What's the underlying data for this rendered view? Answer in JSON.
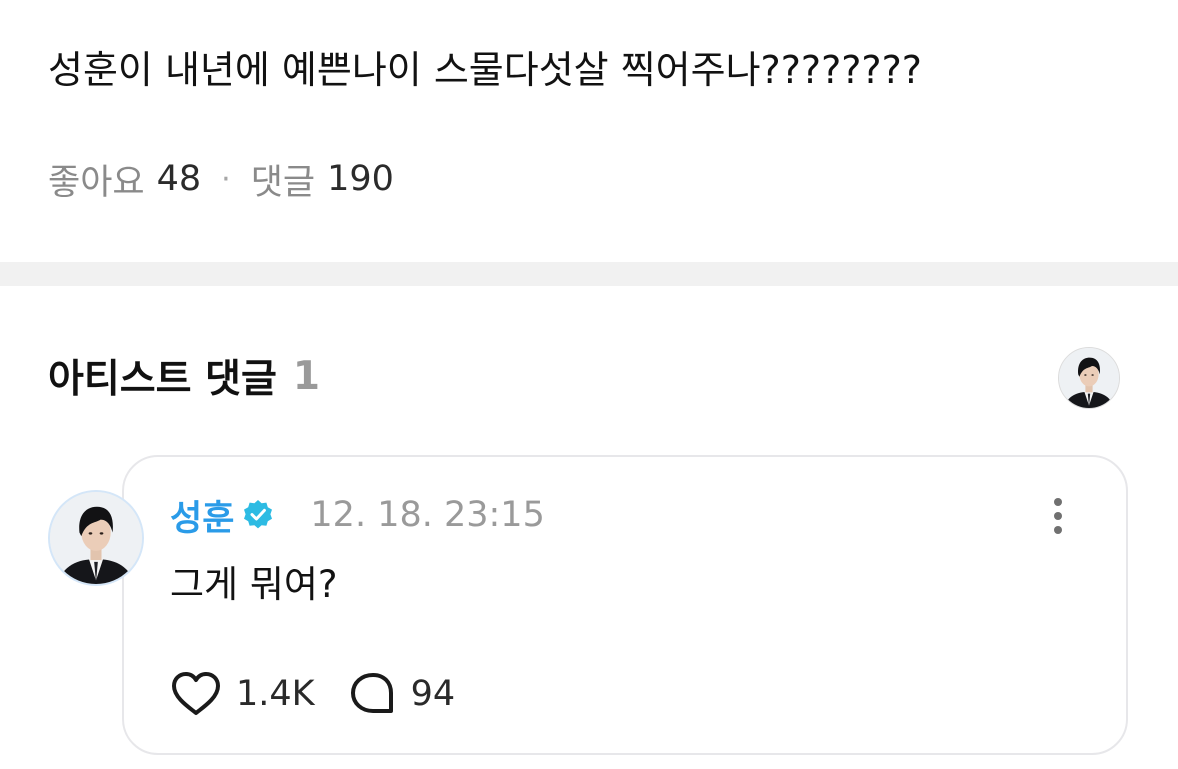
{
  "post": {
    "text": "성훈이 내년에 예쁜나이 스물다섯살 찍어주나????????"
  },
  "stats": {
    "likes_label": "좋아요",
    "likes_count": "48",
    "separator": "·",
    "comments_label": "댓글",
    "comments_count": "190"
  },
  "artist_section": {
    "title": "아티스트 댓글",
    "count": "1"
  },
  "comment": {
    "author": "성훈",
    "time": "12. 18. 23:15",
    "text": "그게 뭐여?",
    "likes": "1.4K",
    "replies": "94"
  },
  "icons": {
    "verified": "verified-badge-icon",
    "more": "more-vertical-icon",
    "like": "heart-icon",
    "reply": "speech-bubble-icon"
  },
  "colors": {
    "author_accent": "#2a9be8",
    "verified_badge": "#2dbbe3",
    "muted_text": "#8a8a8a",
    "divider": "#f1f1f1"
  }
}
